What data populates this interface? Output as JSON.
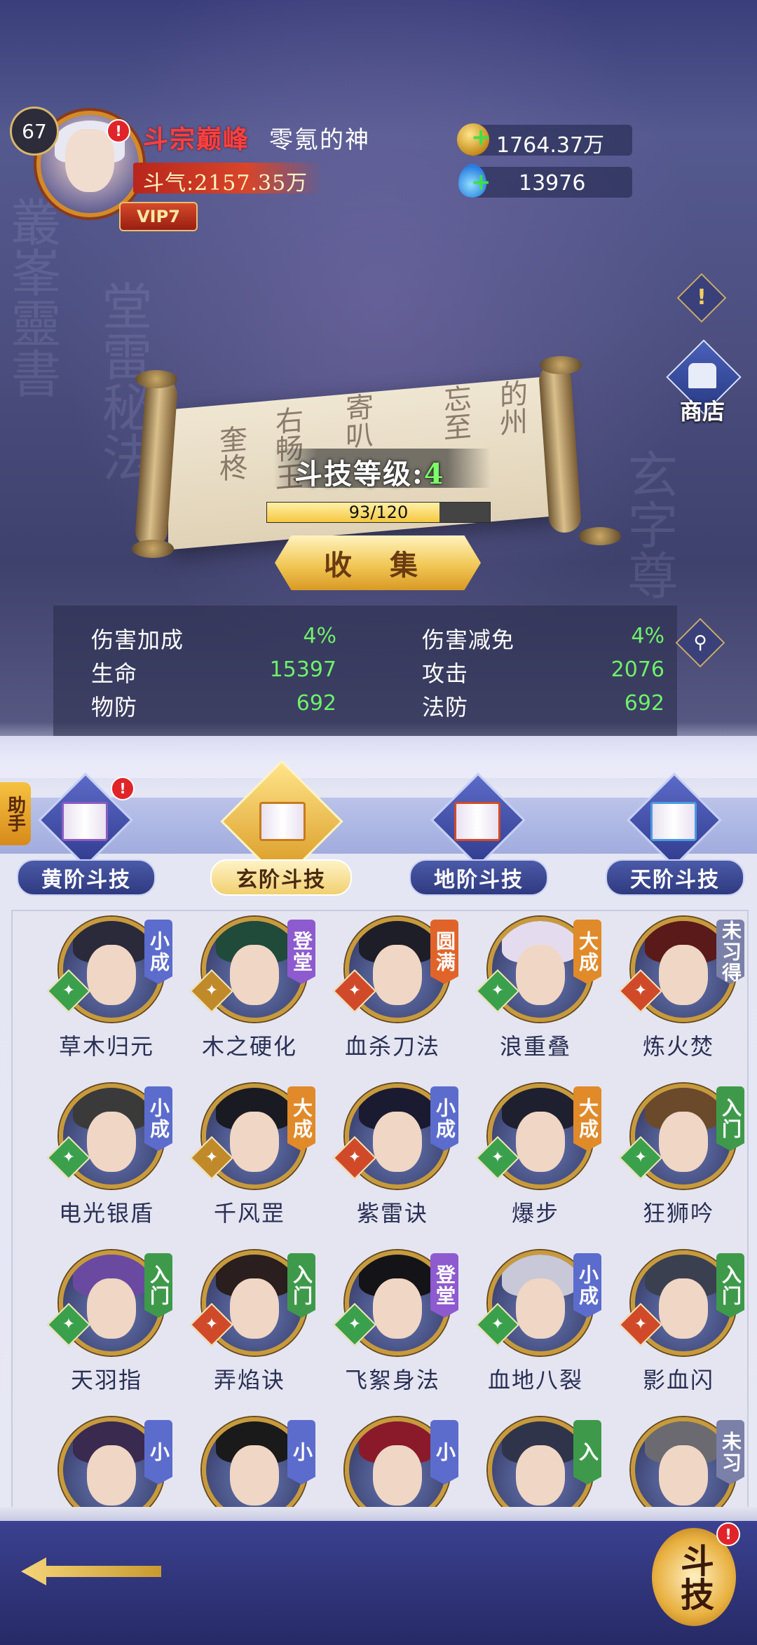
{
  "player": {
    "level": "67",
    "rank_title": "斗宗巅峰",
    "name": "零氪的神",
    "power": "斗气:2157.35万",
    "vip": "VIP7"
  },
  "currencies": {
    "gold": "1764.37万",
    "gems": "13976"
  },
  "side_buttons": {
    "info": "!",
    "shop": "商店"
  },
  "skill_panel": {
    "level_label": "斗技等级:",
    "level_value": "4",
    "progress_text": "93/120",
    "progress_fraction": 0.775,
    "collect_button": "收 集"
  },
  "stats": [
    {
      "label": "伤害加成",
      "value": "4%"
    },
    {
      "label": "伤害减免",
      "value": "4%"
    },
    {
      "label": "生命",
      "value": "15397"
    },
    {
      "label": "攻击",
      "value": "2076"
    },
    {
      "label": "物防",
      "value": "692"
    },
    {
      "label": "法防",
      "value": "692"
    }
  ],
  "helper_tab": "助手",
  "tabs": [
    {
      "label": "黄阶斗技",
      "active": false
    },
    {
      "label": "玄阶斗技",
      "active": true
    },
    {
      "label": "地阶斗技",
      "active": false
    },
    {
      "label": "天阶斗技",
      "active": false
    }
  ],
  "skills": [
    {
      "name": "草木归元",
      "rank": "小成",
      "rank_color": "#5c6ccd",
      "element": "lotus",
      "element_color": "#3aa04c"
    },
    {
      "name": "木之硬化",
      "rank": "登堂",
      "rank_color": "#8e5ad0",
      "element": "shield",
      "element_color": "#c08a2a"
    },
    {
      "name": "血杀刀法",
      "rank": "圆满",
      "rank_color": "#e0642a",
      "element": "blade",
      "element_color": "#d04a2a"
    },
    {
      "name": "浪重叠",
      "rank": "大成",
      "rank_color": "#e08a2a",
      "element": "lotus",
      "element_color": "#3aa04c"
    },
    {
      "name": "炼火焚",
      "rank": "未习得",
      "rank_color": "#7a80a8",
      "element": "blade",
      "element_color": "#d04a2a"
    },
    {
      "name": "电光银盾",
      "rank": "小成",
      "rank_color": "#5c6ccd",
      "element": "lotus",
      "element_color": "#3aa04c"
    },
    {
      "name": "千风罡",
      "rank": "大成",
      "rank_color": "#e08a2a",
      "element": "shield",
      "element_color": "#c08a2a"
    },
    {
      "name": "紫雷诀",
      "rank": "小成",
      "rank_color": "#5c6ccd",
      "element": "blade",
      "element_color": "#d04a2a"
    },
    {
      "name": "爆步",
      "rank": "大成",
      "rank_color": "#e08a2a",
      "element": "lotus",
      "element_color": "#3aa04c"
    },
    {
      "name": "狂狮吟",
      "rank": "入门",
      "rank_color": "#3e9a4a",
      "element": "lotus",
      "element_color": "#3aa04c"
    },
    {
      "name": "天羽指",
      "rank": "入门",
      "rank_color": "#3e9a4a",
      "element": "lotus",
      "element_color": "#3aa04c"
    },
    {
      "name": "弄焰诀",
      "rank": "入门",
      "rank_color": "#3e9a4a",
      "element": "blade",
      "element_color": "#d04a2a"
    },
    {
      "name": "飞絮身法",
      "rank": "登堂",
      "rank_color": "#8e5ad0",
      "element": "lotus",
      "element_color": "#3aa04c"
    },
    {
      "name": "血地八裂",
      "rank": "小成",
      "rank_color": "#5c6ccd",
      "element": "lotus",
      "element_color": "#3aa04c"
    },
    {
      "name": "影血闪",
      "rank": "入门",
      "rank_color": "#3e9a4a",
      "element": "blade",
      "element_color": "#d04a2a"
    },
    {
      "name": "",
      "rank": "小",
      "rank_color": "#5c6ccd",
      "element": "",
      "element_color": "#3aa04c"
    },
    {
      "name": "",
      "rank": "小",
      "rank_color": "#5c6ccd",
      "element": "",
      "element_color": "#3aa04c"
    },
    {
      "name": "",
      "rank": "小",
      "rank_color": "#5c6ccd",
      "element": "",
      "element_color": "#3aa04c"
    },
    {
      "name": "",
      "rank": "入",
      "rank_color": "#3e9a4a",
      "element": "",
      "element_color": "#3aa04c"
    },
    {
      "name": "",
      "rank": "未习",
      "rank_color": "#7a80a8",
      "element": "",
      "element_color": "#3aa04c"
    }
  ],
  "bottom": {
    "douji_button": "斗技"
  },
  "notification_badge": "!"
}
